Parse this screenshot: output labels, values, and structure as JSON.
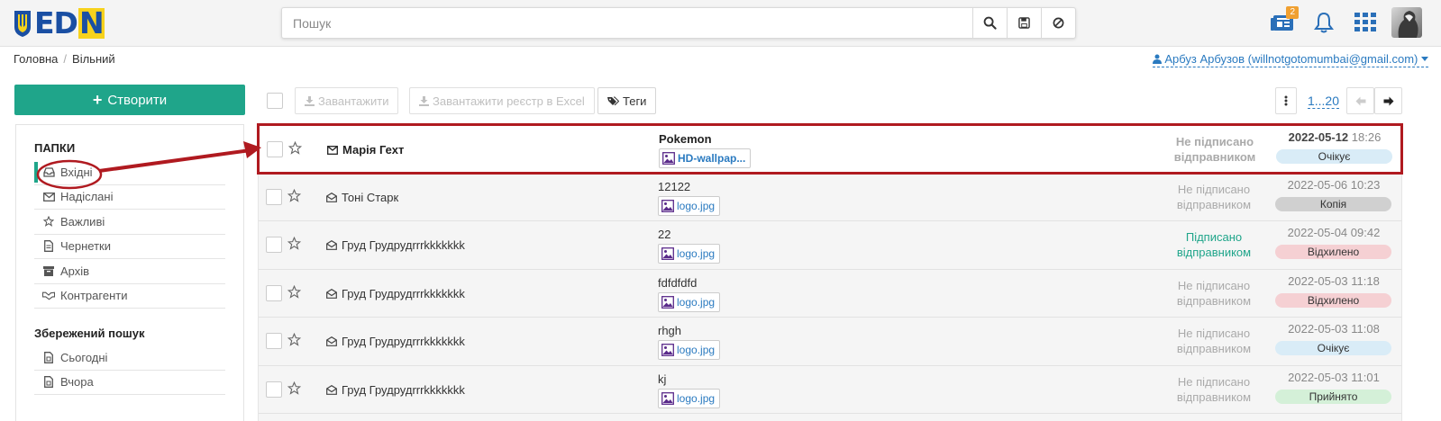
{
  "header": {
    "search_placeholder": "Пошук",
    "notification_count": "2",
    "icons": [
      "search-icon",
      "save-icon",
      "clear-icon",
      "documents-icon",
      "bell-icon",
      "apps-grid-icon"
    ]
  },
  "breadcrumb": {
    "home": "Головна",
    "current": "Вільний"
  },
  "user": {
    "name": "Арбуз Арбузов (willnotgotomumbai@gmail.com)"
  },
  "sidebar": {
    "create_label": "Створити",
    "folders_title": "ПАПКИ",
    "folders": [
      {
        "label": "Вхідні",
        "icon": "inbox-icon"
      },
      {
        "label": "Надіслані",
        "icon": "envelope-icon"
      },
      {
        "label": "Важливі",
        "icon": "star-icon"
      },
      {
        "label": "Чернетки",
        "icon": "draft-icon"
      },
      {
        "label": "Архів",
        "icon": "archive-icon"
      },
      {
        "label": "Контрагенти",
        "icon": "handshake-icon"
      }
    ],
    "saved_title": "Збережений пошук",
    "saved": [
      {
        "label": "Сьогодні",
        "icon": "calendar-icon"
      },
      {
        "label": "Вчора",
        "icon": "calendar-icon"
      }
    ]
  },
  "toolbar": {
    "download": "Завантажити",
    "download_excel": "Завантажити реєстр в Excel",
    "tags": "Теги",
    "pages": "1...20"
  },
  "colors": {
    "accent": "#1fa58a",
    "link": "#2a7ac0",
    "highlight": "#b01a20",
    "tag_waiting": "#d9ecf7",
    "tag_copy": "#d0d0d0",
    "tag_rejected": "#f5d0d3",
    "tag_accepted": "#d4f0d8"
  },
  "messages": [
    {
      "sender": "Марія Гехт",
      "subject": "Pokemon",
      "file": "HD-wallpap...",
      "status": "Не підписано відправником",
      "date": "2022-05-12",
      "time": "18:26",
      "tag": "Очікує",
      "tag_color": "#d9ecf7",
      "unread": true,
      "signed": false
    },
    {
      "sender": "Тоні Старк",
      "subject": "12122",
      "file": "logo.jpg",
      "status": "Не підписано відправником",
      "date": "2022-05-06",
      "time": "10:23",
      "tag": "Копія",
      "tag_color": "#d0d0d0",
      "unread": false,
      "signed": false
    },
    {
      "sender": "Груд Грудрудrrrkkkkkkk",
      "subject": "22",
      "file": "logo.jpg",
      "status": "Підписано відправником",
      "date": "2022-05-04",
      "time": "09:42",
      "tag": "Відхилено",
      "tag_color": "#f5d0d3",
      "unread": false,
      "signed": true
    },
    {
      "sender": "Груд Грудрудrrrkkkkkkk",
      "subject": "fdfdfdfd",
      "file": "logo.jpg",
      "status": "Не підписано відправником",
      "date": "2022-05-03",
      "time": "11:18",
      "tag": "Відхилено",
      "tag_color": "#f5d0d3",
      "unread": false,
      "signed": false
    },
    {
      "sender": "Груд Грудрудrrrkkkkkkk",
      "subject": "rhgh",
      "file": "logo.jpg",
      "status": "Не підписано відправником",
      "date": "2022-05-03",
      "time": "11:08",
      "tag": "Очікує",
      "tag_color": "#d9ecf7",
      "unread": false,
      "signed": false
    },
    {
      "sender": "Груд Грудрудrrrkkkkkkk",
      "subject": "kj",
      "file": "logo.jpg",
      "status": "Не підписано відправником",
      "date": "2022-05-03",
      "time": "11:01",
      "tag": "Прийнято",
      "tag_color": "#d4f0d8",
      "unread": false,
      "signed": false
    }
  ]
}
